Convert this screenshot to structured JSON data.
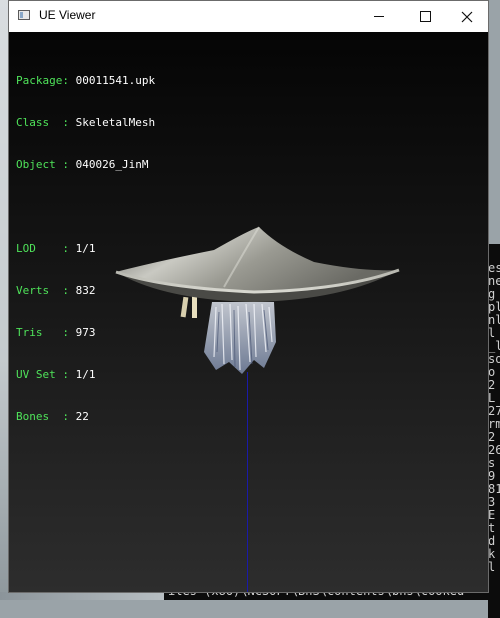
{
  "window": {
    "title": "UE Viewer"
  },
  "info": {
    "package": {
      "key": "Package: ",
      "value": "00011541.upk"
    },
    "class": {
      "key": "Class  : ",
      "value": "SkeletalMesh"
    },
    "object": {
      "key": "Object : ",
      "value": "040026_JinM"
    },
    "lod": {
      "key": "LOD    : ",
      "value": "1/1"
    },
    "verts": {
      "key": "Verts  : ",
      "value": "832"
    },
    "tris": {
      "key": "Tris   : ",
      "value": "973"
    },
    "uvset": {
      "key": "UV Set : ",
      "value": "1/1"
    },
    "bones": {
      "key": "Bones  : ",
      "value": "22"
    }
  },
  "colors": {
    "label": "#4fe35a",
    "value": "#ffffff",
    "bone_axis": "#1a1aa8"
  },
  "icons": {
    "app": "window-icon",
    "minimize": "minimize-icon",
    "maximize": "maximize-icon",
    "close": "close-icon"
  },
  "background": {
    "terminal_lines": [
      "es",
      "ne",
      "g",
      "pl",
      "nl",
      "l",
      "_l",
      "so",
      "o",
      "2",
      "L",
      "27",
      "rm",
      "2",
      "26",
      "s",
      "9",
      "81",
      "3",
      "E",
      "t",
      "d",
      "k",
      "l"
    ],
    "bottom_text": "iles  (x86)\\NCSOFT\\BnS\\contents\\bns\\cooked"
  }
}
